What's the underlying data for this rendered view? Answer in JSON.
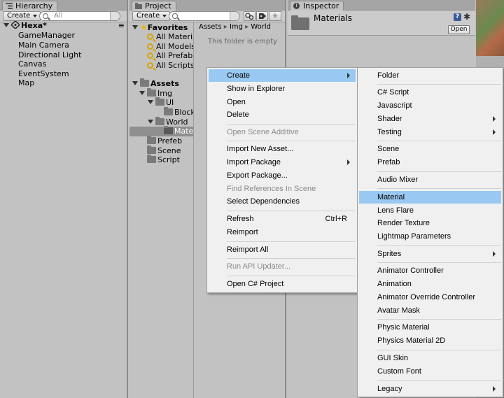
{
  "hierarchy": {
    "tab": "Hierarchy",
    "create": "Create",
    "search_placeholder": "All",
    "scene": "Hexa*",
    "items": [
      "GameManager",
      "Main Camera",
      "Directional Light",
      "Canvas",
      "EventSystem",
      "Map"
    ]
  },
  "project": {
    "tab": "Project",
    "create": "Create",
    "favorites": "Favorites",
    "fav_items": [
      "All Materia",
      "All Models",
      "All Prefabs",
      "All Scripts"
    ],
    "assets": "Assets",
    "tree": {
      "img": "Img",
      "ui": "UI",
      "blocks": "Blocks",
      "world": "World",
      "mater": "Mater",
      "prefeb": "Prefeb",
      "scene": "Scene",
      "script": "Script"
    },
    "breadcrumb": [
      "Assets",
      "Img",
      "World"
    ],
    "empty_msg": "This folder is empty"
  },
  "inspector": {
    "tab": "Inspector",
    "title": "Materials",
    "open": "Open"
  },
  "context_menu": {
    "items": [
      {
        "label": "Create",
        "submenu": true,
        "highlight": true
      },
      {
        "label": "Show in Explorer"
      },
      {
        "label": "Open"
      },
      {
        "label": "Delete"
      },
      {
        "label": "Open Scene Additive",
        "disabled": true
      },
      {
        "label": "Import New Asset..."
      },
      {
        "label": "Import Package",
        "submenu": true
      },
      {
        "label": "Export Package..."
      },
      {
        "label": "Find References In Scene",
        "disabled": true
      },
      {
        "label": "Select Dependencies"
      },
      {
        "label": "Refresh",
        "shortcut": "Ctrl+R"
      },
      {
        "label": "Reimport"
      },
      {
        "label": "Reimport All"
      },
      {
        "label": "Run API Updater...",
        "disabled": true
      },
      {
        "label": "Open C# Project"
      }
    ]
  },
  "create_menu": {
    "items": [
      {
        "label": "Folder"
      },
      {
        "label": "C# Script"
      },
      {
        "label": "Javascript"
      },
      {
        "label": "Shader",
        "submenu": true
      },
      {
        "label": "Testing",
        "submenu": true
      },
      {
        "label": "Scene"
      },
      {
        "label": "Prefab"
      },
      {
        "label": "Audio Mixer"
      },
      {
        "label": "Material",
        "highlight": true
      },
      {
        "label": "Lens Flare"
      },
      {
        "label": "Render Texture"
      },
      {
        "label": "Lightmap Parameters"
      },
      {
        "label": "Sprites",
        "submenu": true
      },
      {
        "label": "Animator Controller"
      },
      {
        "label": "Animation"
      },
      {
        "label": "Animator Override Controller"
      },
      {
        "label": "Avatar Mask"
      },
      {
        "label": "Physic Material"
      },
      {
        "label": "Physics Material 2D"
      },
      {
        "label": "GUI Skin"
      },
      {
        "label": "Custom Font"
      },
      {
        "label": "Legacy",
        "submenu": true
      }
    ]
  }
}
